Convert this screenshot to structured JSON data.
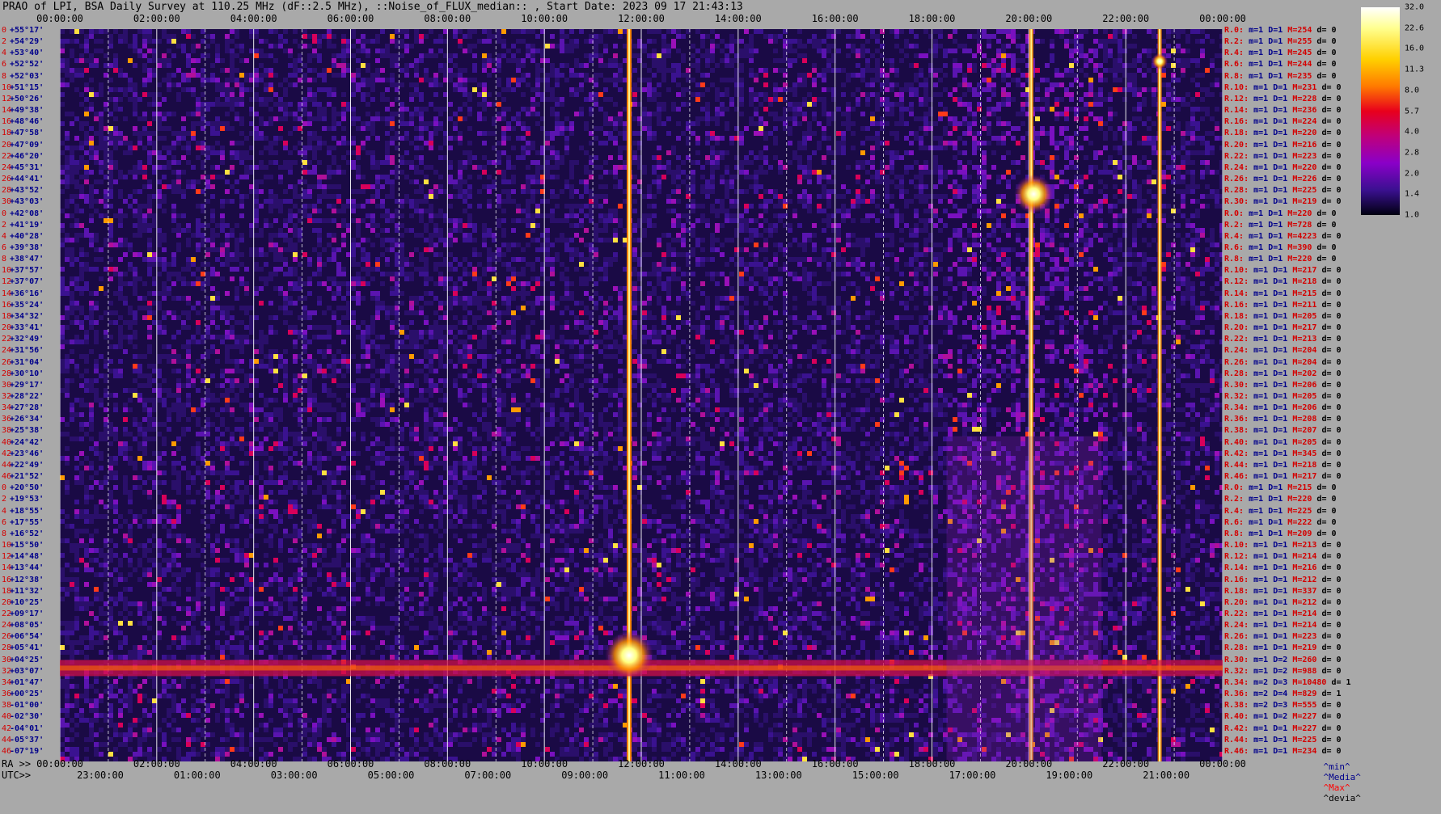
{
  "header": {
    "title": "PRAO of LPI, BSA Daily Survey at 110.25 MHz (dF::2.5 MHz), ::Noise_of_FLUX_median:: , Start Date: 2023 09 17 21:43:13"
  },
  "chart_data": {
    "type": "heatmap",
    "title": "PRAO of LPI, BSA Daily Survey at 110.25 MHz (dF::2.5 MHz), ::Noise_of_FLUX_median:: , Start Date: 2023 09 17 21:43:13",
    "top_axis_ticks": [
      "00:00:00",
      "02:00:00",
      "04:00:00",
      "06:00:00",
      "08:00:00",
      "10:00:00",
      "12:00:00",
      "14:00:00",
      "16:00:00",
      "18:00:00",
      "20:00:00",
      "22:00:00",
      "00:00:00"
    ],
    "ra_prefix": "RA >>",
    "ra_ticks": [
      "00:00:00",
      "02:00:00",
      "04:00:00",
      "06:00:00",
      "08:00:00",
      "10:00:00",
      "12:00:00",
      "14:00:00",
      "16:00:00",
      "18:00:00",
      "20:00:00",
      "22:00:00",
      "00:00:00"
    ],
    "utc_prefix": "UTC>>",
    "utc_ticks": [
      "23:00:00",
      "01:00:00",
      "03:00:00",
      "05:00:00",
      "07:00:00",
      "09:00:00",
      "11:00:00",
      "13:00:00",
      "15:00:00",
      "17:00:00",
      "19:00:00",
      "21:00:00"
    ],
    "declinations": [
      "+55°17'",
      "+54°29'",
      "+53°40'",
      "+52°52'",
      "+52°03'",
      "+51°15'",
      "+50°26'",
      "+49°38'",
      "+48°46'",
      "+47°58'",
      "+47°09'",
      "+46°20'",
      "+45°31'",
      "+44°41'",
      "+43°52'",
      "+43°03'",
      "+42°08'",
      "+41°19'",
      "+40°28'",
      "+39°38'",
      "+38°47'",
      "+37°57'",
      "+37°07'",
      "+36°16'",
      "+35°24'",
      "+34°32'",
      "+33°41'",
      "+32°49'",
      "+31°56'",
      "+31°04'",
      "+30°10'",
      "+29°17'",
      "+28°22'",
      "+27°28'",
      "+26°34'",
      "+25°38'",
      "+24°42'",
      "+23°46'",
      "+22°49'",
      "+21°52'",
      "+20°50'",
      "+19°53'",
      "+18°55'",
      "+17°55'",
      "+16°52'",
      "+15°50'",
      "+14°48'",
      "+13°44'",
      "+12°38'",
      "+11°32'",
      "+10°25'",
      "+09°17'",
      "+08°05'",
      "+06°54'",
      "+05°41'",
      "+04°25'",
      "+03°07'",
      "+01°47'",
      "+00°25'",
      "-01°00'",
      "-02°30'",
      "-04°01'",
      "-05°37'",
      "-07°19'"
    ],
    "dec_indices": [
      "0",
      "2",
      "4",
      "6",
      "8",
      "10",
      "12",
      "14",
      "16",
      "18",
      "20",
      "22",
      "24",
      "26",
      "28",
      "30",
      "0",
      "2",
      "4",
      "6",
      "8",
      "10",
      "12",
      "14",
      "16",
      "18",
      "20",
      "22",
      "24",
      "26",
      "28",
      "30",
      "32",
      "34",
      "36",
      "38",
      "40",
      "42",
      "44",
      "46",
      "0",
      "2",
      "4",
      "6",
      "8",
      "10",
      "12",
      "14",
      "16",
      "18",
      "20",
      "22",
      "24",
      "26",
      "28",
      "30",
      "32",
      "34",
      "36",
      "38",
      "40",
      "42",
      "44",
      "46"
    ],
    "stats": [
      {
        "r": "R.0:",
        "m": "m=1",
        "D": "D=1",
        "M": "M=254",
        "d": "d= 0"
      },
      {
        "r": "R.2:",
        "m": "m=1",
        "D": "D=1",
        "M": "M=255",
        "d": "d= 0"
      },
      {
        "r": "R.4:",
        "m": "m=1",
        "D": "D=1",
        "M": "M=245",
        "d": "d= 0"
      },
      {
        "r": "R.6:",
        "m": "m=1",
        "D": "D=1",
        "M": "M=244",
        "d": "d= 0"
      },
      {
        "r": "R.8:",
        "m": "m=1",
        "D": "D=1",
        "M": "M=235",
        "d": "d= 0"
      },
      {
        "r": "R.10:",
        "m": "m=1",
        "D": "D=1",
        "M": "M=231",
        "d": "d= 0"
      },
      {
        "r": "R.12:",
        "m": "m=1",
        "D": "D=1",
        "M": "M=228",
        "d": "d= 0"
      },
      {
        "r": "R.14:",
        "m": "m=1",
        "D": "D=1",
        "M": "M=236",
        "d": "d= 0"
      },
      {
        "r": "R.16:",
        "m": "m=1",
        "D": "D=1",
        "M": "M=224",
        "d": "d= 0"
      },
      {
        "r": "R.18:",
        "m": "m=1",
        "D": "D=1",
        "M": "M=220",
        "d": "d= 0"
      },
      {
        "r": "R.20:",
        "m": "m=1",
        "D": "D=1",
        "M": "M=216",
        "d": "d= 0"
      },
      {
        "r": "R.22:",
        "m": "m=1",
        "D": "D=1",
        "M": "M=223",
        "d": "d= 0"
      },
      {
        "r": "R.24:",
        "m": "m=1",
        "D": "D=1",
        "M": "M=220",
        "d": "d= 0"
      },
      {
        "r": "R.26:",
        "m": "m=1",
        "D": "D=1",
        "M": "M=226",
        "d": "d= 0"
      },
      {
        "r": "R.28:",
        "m": "m=1",
        "D": "D=1",
        "M": "M=225",
        "d": "d= 0"
      },
      {
        "r": "R.30:",
        "m": "m=1",
        "D": "D=1",
        "M": "M=219",
        "d": "d= 0"
      },
      {
        "r": "R.0:",
        "m": "m=1",
        "D": "D=1",
        "M": "M=220",
        "d": "d= 0"
      },
      {
        "r": "R.2:",
        "m": "m=1",
        "D": "D=1",
        "M": "M=728",
        "d": "d= 0"
      },
      {
        "r": "R.4:",
        "m": "m=1",
        "D": "D=1",
        "M": "M=4223",
        "d": "d= 0"
      },
      {
        "r": "R.6:",
        "m": "m=1",
        "D": "D=1",
        "M": "M=390",
        "d": "d= 0"
      },
      {
        "r": "R.8:",
        "m": "m=1",
        "D": "D=1",
        "M": "M=220",
        "d": "d= 0"
      },
      {
        "r": "R.10:",
        "m": "m=1",
        "D": "D=1",
        "M": "M=217",
        "d": "d= 0"
      },
      {
        "r": "R.12:",
        "m": "m=1",
        "D": "D=1",
        "M": "M=218",
        "d": "d= 0"
      },
      {
        "r": "R.14:",
        "m": "m=1",
        "D": "D=1",
        "M": "M=215",
        "d": "d= 0"
      },
      {
        "r": "R.16:",
        "m": "m=1",
        "D": "D=1",
        "M": "M=211",
        "d": "d= 0"
      },
      {
        "r": "R.18:",
        "m": "m=1",
        "D": "D=1",
        "M": "M=205",
        "d": "d= 0"
      },
      {
        "r": "R.20:",
        "m": "m=1",
        "D": "D=1",
        "M": "M=217",
        "d": "d= 0"
      },
      {
        "r": "R.22:",
        "m": "m=1",
        "D": "D=1",
        "M": "M=213",
        "d": "d= 0"
      },
      {
        "r": "R.24:",
        "m": "m=1",
        "D": "D=1",
        "M": "M=204",
        "d": "d= 0"
      },
      {
        "r": "R.26:",
        "m": "m=1",
        "D": "D=1",
        "M": "M=204",
        "d": "d= 0"
      },
      {
        "r": "R.28:",
        "m": "m=1",
        "D": "D=1",
        "M": "M=202",
        "d": "d= 0"
      },
      {
        "r": "R.30:",
        "m": "m=1",
        "D": "D=1",
        "M": "M=206",
        "d": "d= 0"
      },
      {
        "r": "R.32:",
        "m": "m=1",
        "D": "D=1",
        "M": "M=205",
        "d": "d= 0"
      },
      {
        "r": "R.34:",
        "m": "m=1",
        "D": "D=1",
        "M": "M=206",
        "d": "d= 0"
      },
      {
        "r": "R.36:",
        "m": "m=1",
        "D": "D=1",
        "M": "M=208",
        "d": "d= 0"
      },
      {
        "r": "R.38:",
        "m": "m=1",
        "D": "D=1",
        "M": "M=207",
        "d": "d= 0"
      },
      {
        "r": "R.40:",
        "m": "m=1",
        "D": "D=1",
        "M": "M=205",
        "d": "d= 0"
      },
      {
        "r": "R.42:",
        "m": "m=1",
        "D": "D=1",
        "M": "M=345",
        "d": "d= 0"
      },
      {
        "r": "R.44:",
        "m": "m=1",
        "D": "D=1",
        "M": "M=218",
        "d": "d= 0"
      },
      {
        "r": "R.46:",
        "m": "m=1",
        "D": "D=1",
        "M": "M=217",
        "d": "d= 0"
      },
      {
        "r": "R.0:",
        "m": "m=1",
        "D": "D=1",
        "M": "M=215",
        "d": "d= 0"
      },
      {
        "r": "R.2:",
        "m": "m=1",
        "D": "D=1",
        "M": "M=220",
        "d": "d= 0"
      },
      {
        "r": "R.4:",
        "m": "m=1",
        "D": "D=1",
        "M": "M=225",
        "d": "d= 0"
      },
      {
        "r": "R.6:",
        "m": "m=1",
        "D": "D=1",
        "M": "M=222",
        "d": "d= 0"
      },
      {
        "r": "R.8:",
        "m": "m=1",
        "D": "D=1",
        "M": "M=209",
        "d": "d= 0"
      },
      {
        "r": "R.10:",
        "m": "m=1",
        "D": "D=1",
        "M": "M=213",
        "d": "d= 0"
      },
      {
        "r": "R.12:",
        "m": "m=1",
        "D": "D=1",
        "M": "M=214",
        "d": "d= 0"
      },
      {
        "r": "R.14:",
        "m": "m=1",
        "D": "D=1",
        "M": "M=216",
        "d": "d= 0"
      },
      {
        "r": "R.16:",
        "m": "m=1",
        "D": "D=1",
        "M": "M=212",
        "d": "d= 0"
      },
      {
        "r": "R.18:",
        "m": "m=1",
        "D": "D=1",
        "M": "M=337",
        "d": "d= 0"
      },
      {
        "r": "R.20:",
        "m": "m=1",
        "D": "D=1",
        "M": "M=212",
        "d": "d= 0"
      },
      {
        "r": "R.22:",
        "m": "m=1",
        "D": "D=1",
        "M": "M=214",
        "d": "d= 0"
      },
      {
        "r": "R.24:",
        "m": "m=1",
        "D": "D=1",
        "M": "M=214",
        "d": "d= 0"
      },
      {
        "r": "R.26:",
        "m": "m=1",
        "D": "D=1",
        "M": "M=223",
        "d": "d= 0"
      },
      {
        "r": "R.28:",
        "m": "m=1",
        "D": "D=1",
        "M": "M=219",
        "d": "d= 0"
      },
      {
        "r": "R.30:",
        "m": "m=1",
        "D": "D=2",
        "M": "M=260",
        "d": "d= 0"
      },
      {
        "r": "R.32:",
        "m": "m=1",
        "D": "D=2",
        "M": "M=988",
        "d": "d= 0"
      },
      {
        "r": "R.34:",
        "m": "m=2",
        "D": "D=3",
        "M": "M=10480",
        "d": "d= 1"
      },
      {
        "r": "R.36:",
        "m": "m=2",
        "D": "D=4",
        "M": "M=829",
        "d": "d= 1"
      },
      {
        "r": "R.38:",
        "m": "m=2",
        "D": "D=3",
        "M": "M=555",
        "d": "d= 0"
      },
      {
        "r": "R.40:",
        "m": "m=1",
        "D": "D=2",
        "M": "M=227",
        "d": "d= 0"
      },
      {
        "r": "R.42:",
        "m": "m=1",
        "D": "D=1",
        "M": "M=227",
        "d": "d= 0"
      },
      {
        "r": "R.44:",
        "m": "m=1",
        "D": "D=1",
        "M": "M=225",
        "d": "d= 0"
      },
      {
        "r": "R.46:",
        "m": "m=1",
        "D": "D=1",
        "M": "M=234",
        "d": "d= 0"
      }
    ],
    "colorbar": {
      "ticks": [
        "32.0",
        "22.6",
        "16.0",
        "11.3",
        "8.0",
        "5.7",
        "4.0",
        "2.8",
        "2.0",
        "1.4",
        "1.0"
      ],
      "range": [
        1.0,
        32.0
      ]
    },
    "footer": {
      "min": "^min^",
      "median": "^Media^",
      "max": "^Max^",
      "devia": "^devia^"
    },
    "features": [
      {
        "kind": "vline",
        "t": 11.75,
        "width": 6,
        "intensity": 0.95
      },
      {
        "kind": "vline",
        "t": 20.05,
        "width": 5,
        "intensity": 0.9
      },
      {
        "kind": "vline",
        "t": 22.7,
        "width": 5,
        "intensity": 0.85
      },
      {
        "kind": "hband",
        "dec_from": 0.6,
        "dec_to": -0.8,
        "intensity": 0.75
      },
      {
        "kind": "bright_blob",
        "t": 11.75,
        "dec": 1.0,
        "radius": 30
      },
      {
        "kind": "bright_blob",
        "t": 20.1,
        "dec": 41.0,
        "radius": 24
      },
      {
        "kind": "bright_blob",
        "t": 22.7,
        "dec": 52.5,
        "radius": 10
      }
    ],
    "colors": {
      "background": "#a9a9a9",
      "plot_base": "#1a0a45",
      "label_red": "#d40000",
      "label_blue": "#00008b"
    },
    "grid": true
  }
}
